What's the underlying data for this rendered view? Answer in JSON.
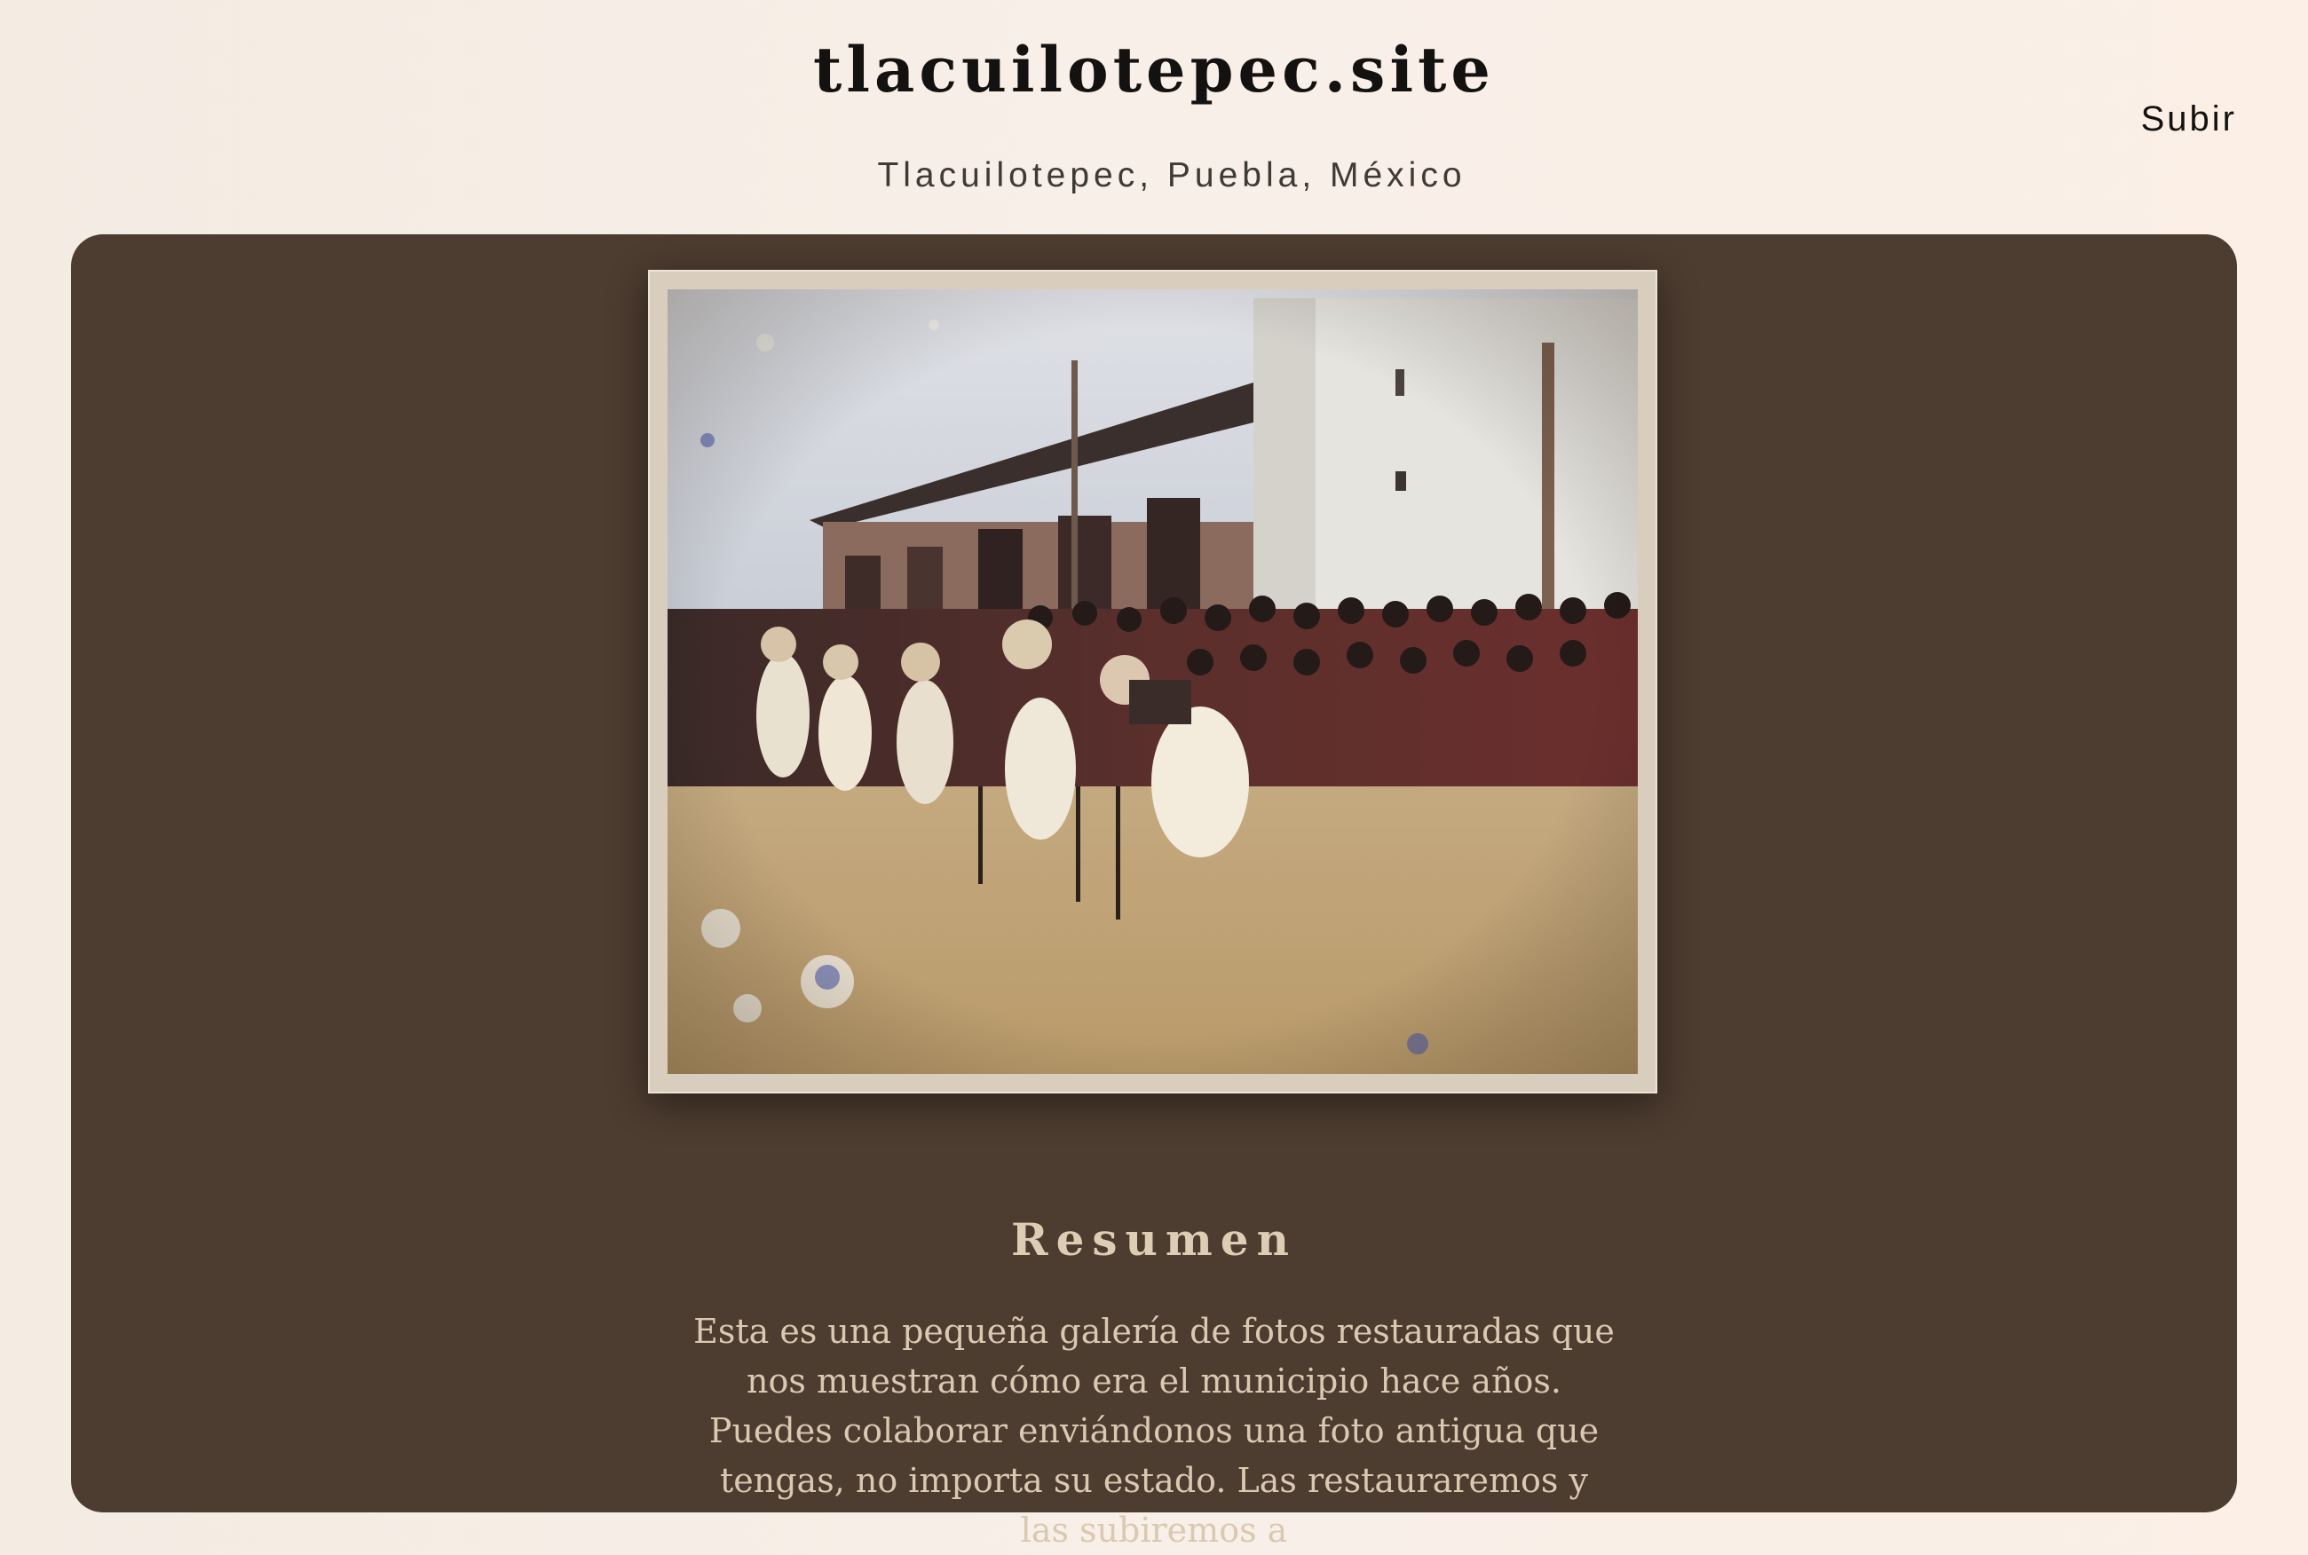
{
  "header": {
    "site_title": "tlacuilotepec.site",
    "subtitle": "Tlacuilotepec, Puebla, México",
    "nav_link": "Subir"
  },
  "main": {
    "photo": {
      "icon": "restored-photo-image"
    },
    "summary": {
      "heading": "Resumen",
      "text": "Esta es una pequeña galería de fotos restauradas que nos muestran cómo era el municipio hace años. Puedes colaborar enviándonos una foto antigua que tengas, no importa su estado. Las restauraremos y las subiremos a"
    }
  },
  "colors": {
    "page_background": "#f6eee6",
    "panel_background": "#4d3c30",
    "heading_text": "#dccdb4",
    "body_text": "#d9c9b0",
    "title_text": "#141210"
  }
}
